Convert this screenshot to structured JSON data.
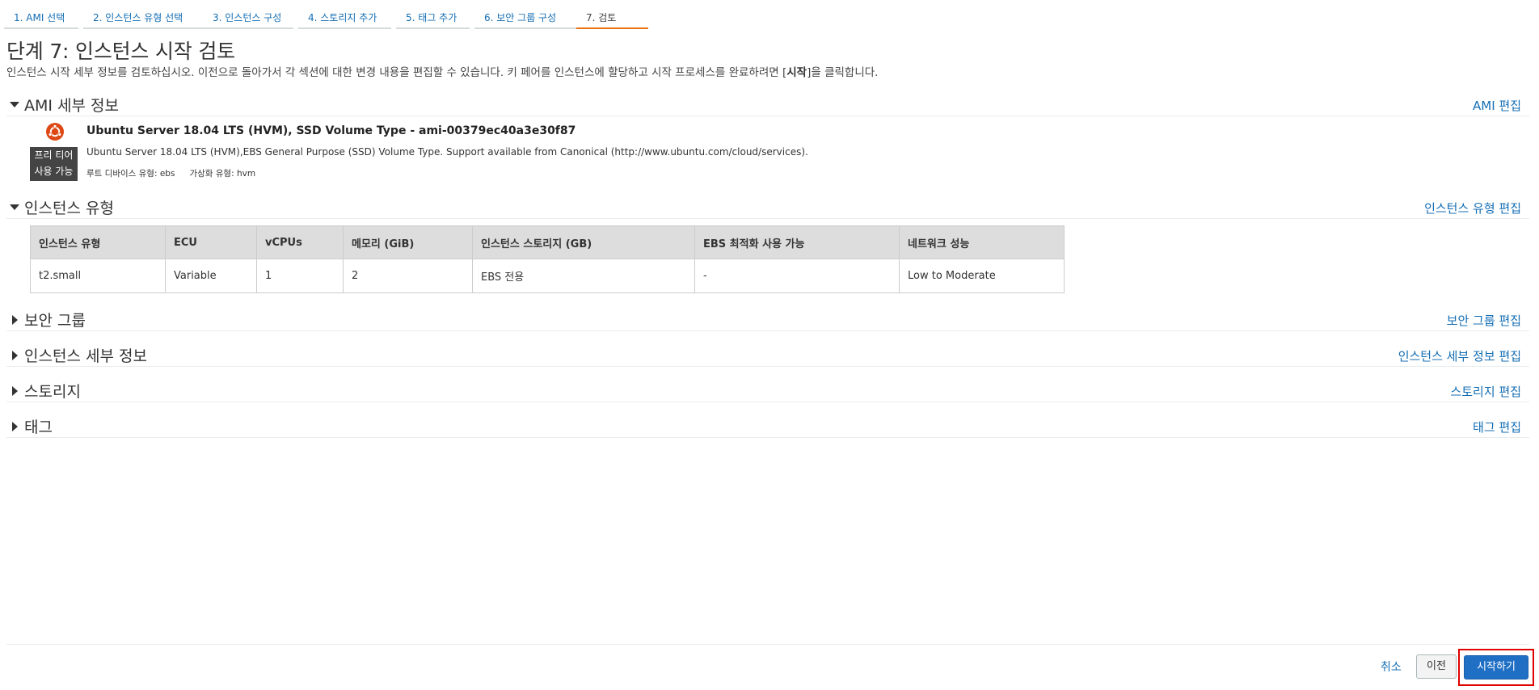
{
  "wizard": {
    "steps": [
      {
        "label": "1. AMI 선택"
      },
      {
        "label": "2. 인스턴스 유형 선택"
      },
      {
        "label": "3. 인스턴스 구성"
      },
      {
        "label": "4. 스토리지 추가"
      },
      {
        "label": "5. 태그 추가"
      },
      {
        "label": "6. 보안 그룹 구성"
      },
      {
        "label": "7. 검토"
      }
    ],
    "active_step": 7
  },
  "page": {
    "title": "단계 7: 인스턴스 시작 검토",
    "subtitle_before": "인스턴스 시작 세부 정보를 검토하십시오. 이전으로 돌아가서 각 섹션에 대한 변경 내용을 편집할 수 있습니다. 키 페어를 인스턴스에 할당하고 시작 프로세스를 완료하려면 [",
    "subtitle_bold": "시작",
    "subtitle_after": "]을 클릭합니다."
  },
  "sections": {
    "ami": {
      "label": "AMI 세부 정보",
      "edit": "AMI 편집",
      "expanded": true
    },
    "instance_type": {
      "label": "인스턴스 유형",
      "edit": "인스턴스 유형 편집",
      "expanded": true
    },
    "security_group": {
      "label": "보안 그룹",
      "edit": "보안 그룹 편집",
      "expanded": false
    },
    "instance_details": {
      "label": "인스턴스 세부 정보",
      "edit": "인스턴스 세부 정보 편집",
      "expanded": false
    },
    "storage": {
      "label": "스토리지",
      "edit": "스토리지 편집",
      "expanded": false
    },
    "tags": {
      "label": "태그",
      "edit": "태그 편집",
      "expanded": false
    }
  },
  "ami": {
    "logo_icon": "ubuntu-logo-icon",
    "badge_line1": "프리 티어",
    "badge_line2": "사용 가능",
    "name": "Ubuntu Server 18.04 LTS (HVM), SSD Volume Type - ami-00379ec40a3e30f87",
    "description": "Ubuntu Server 18.04 LTS (HVM),EBS General Purpose (SSD) Volume Type. Support available from Canonical (http://www.ubuntu.com/cloud/services).",
    "root_device": "루트 디바이스 유형: ebs",
    "virtualization": "가상화 유형: hvm"
  },
  "instance_table": {
    "headers": [
      "인스턴스 유형",
      "ECU",
      "vCPUs",
      "메모리 (GiB)",
      "인스턴스 스토리지 (GB)",
      "EBS 최적화 사용 가능",
      "네트워크 성능"
    ],
    "rows": [
      [
        "t2.small",
        "Variable",
        "1",
        "2",
        "EBS 전용",
        "-",
        "Low to Moderate"
      ]
    ]
  },
  "footer": {
    "cancel": "취소",
    "previous": "이전",
    "launch": "시작하기"
  },
  "colors": {
    "link": "#146eb4",
    "active_tab": "#ec7211",
    "launch_button": "#1f6fc5",
    "highlight_border": "#e00000",
    "ubuntu_orange": "#dd4814"
  }
}
